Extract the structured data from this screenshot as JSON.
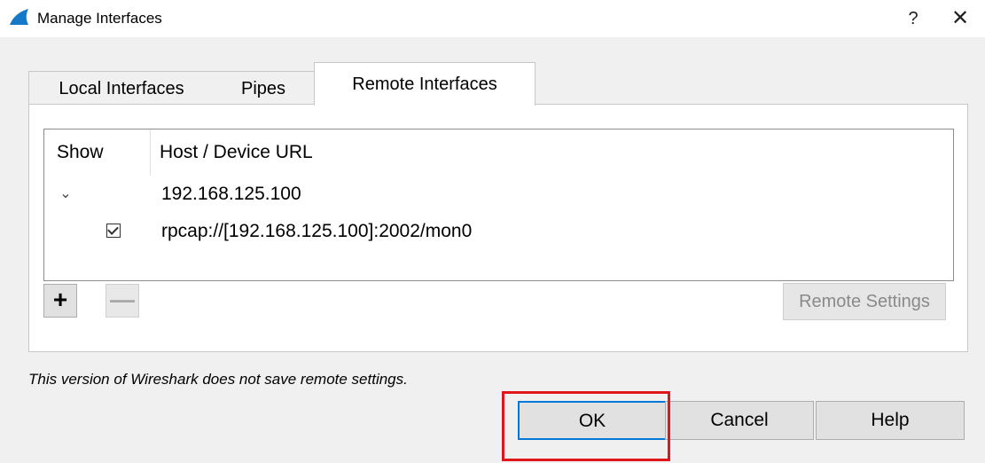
{
  "window": {
    "title": "Manage Interfaces",
    "help_glyph": "?",
    "close_glyph": "✕",
    "icon": "wireshark-fin-icon",
    "icon_color": "#1679c8"
  },
  "tabs": [
    {
      "label": "Local Interfaces",
      "selected": false
    },
    {
      "label": "Pipes",
      "selected": false
    },
    {
      "label": "Remote Interfaces",
      "selected": true
    }
  ],
  "tree": {
    "columns": [
      "Show",
      "Host / Device URL"
    ],
    "host": {
      "expand_glyph": "⌄",
      "label": "192.168.125.100"
    },
    "interface": {
      "checked": true,
      "url": "rpcap://[192.168.125.100]:2002/mon0"
    }
  },
  "buttons": {
    "add_glyph": "+",
    "remove_glyph": "—",
    "remote_settings": "Remote Settings",
    "ok": "OK",
    "cancel": "Cancel",
    "help": "Help"
  },
  "footer": {
    "note": "This version of Wireshark does not save remote settings."
  },
  "colors": {
    "highlight": "#e0161b",
    "focus": "#0078d7"
  }
}
